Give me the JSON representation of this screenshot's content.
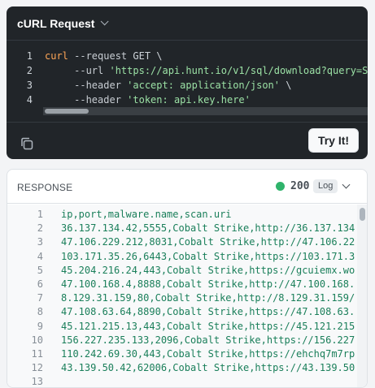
{
  "request": {
    "title": "cURL Request",
    "code_lines": [
      {
        "n": "1",
        "parts": [
          {
            "t": "curl",
            "c": "kw"
          },
          {
            "t": " --request ",
            "c": "opt"
          },
          {
            "t": "GET",
            "c": "plain"
          },
          {
            "t": " \\",
            "c": "plain"
          }
        ]
      },
      {
        "n": "2",
        "parts": [
          {
            "t": "     --url ",
            "c": "opt"
          },
          {
            "t": "'https://api.hunt.io/v1/sql/download?query=S",
            "c": "str"
          }
        ]
      },
      {
        "n": "3",
        "parts": [
          {
            "t": "     --header ",
            "c": "opt"
          },
          {
            "t": "'accept: application/json'",
            "c": "str"
          },
          {
            "t": " \\",
            "c": "plain"
          }
        ]
      },
      {
        "n": "4",
        "parts": [
          {
            "t": "     --header ",
            "c": "opt"
          },
          {
            "t": "'token: api.key.here'",
            "c": "str"
          }
        ]
      }
    ],
    "copy_icon": "copy-icon",
    "try_label": "Try It!"
  },
  "response": {
    "title": "RESPONSE",
    "status_code": "200",
    "log_label": "Log",
    "status_color": "#2fb36b",
    "lines": [
      {
        "n": "1",
        "text": "ip,port,malware.name,scan.uri"
      },
      {
        "n": "2",
        "text": "36.137.134.42,5555,Cobalt Strike,http://36.137.134"
      },
      {
        "n": "3",
        "text": "47.106.229.212,8031,Cobalt Strike,http://47.106.22"
      },
      {
        "n": "4",
        "text": "103.171.35.26,6443,Cobalt Strike,https://103.171.3"
      },
      {
        "n": "5",
        "text": "45.204.216.24,443,Cobalt Strike,https://gcuiemx.wo"
      },
      {
        "n": "6",
        "text": "47.100.168.4,8888,Cobalt Strike,http://47.100.168."
      },
      {
        "n": "7",
        "text": "8.129.31.159,80,Cobalt Strike,http://8.129.31.159/"
      },
      {
        "n": "8",
        "text": "47.108.63.64,8890,Cobalt Strike,https://47.108.63."
      },
      {
        "n": "9",
        "text": "45.121.215.13,443,Cobalt Strike,https://45.121.215"
      },
      {
        "n": "10",
        "text": "156.227.235.133,2096,Cobalt Strike,https://156.227"
      },
      {
        "n": "11",
        "text": "110.242.69.30,443,Cobalt Strike,https://ehchq7m7rp"
      },
      {
        "n": "12",
        "text": "43.139.50.42,62006,Cobalt Strike,https://43.139.50"
      },
      {
        "n": "13",
        "text": ""
      }
    ]
  }
}
